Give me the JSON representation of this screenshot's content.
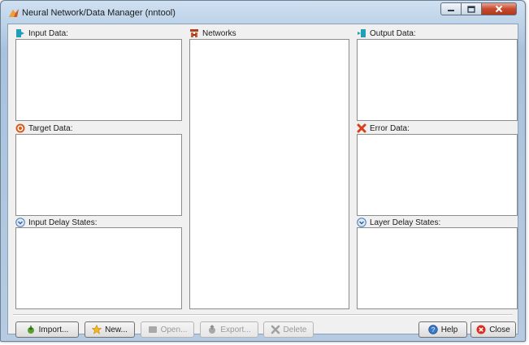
{
  "window": {
    "title": "Neural Network/Data Manager (nntool)"
  },
  "panels": {
    "input_data": "Input Data:",
    "target_data": "Target Data:",
    "input_delay_states": "Input Delay States:",
    "networks": "Networks",
    "output_data": "Output Data:",
    "error_data": "Error Data:",
    "layer_delay_states": "Layer Delay States:"
  },
  "buttons": {
    "import": "Import...",
    "new": "New...",
    "open": "Open...",
    "export": "Export...",
    "delete": "Delete",
    "help": "Help",
    "close": "Close"
  },
  "icons": {
    "title": "matlab-icon",
    "input_data": "data-arrow-icon",
    "target_data": "target-icon",
    "input_delay_states": "chevron-circle-icon",
    "networks": "network-icon",
    "output_data": "data-arrow-icon",
    "error_data": "error-cross-icon",
    "layer_delay_states": "chevron-circle-icon"
  },
  "states": {
    "open_enabled": false,
    "export_enabled": false,
    "delete_enabled": false
  }
}
